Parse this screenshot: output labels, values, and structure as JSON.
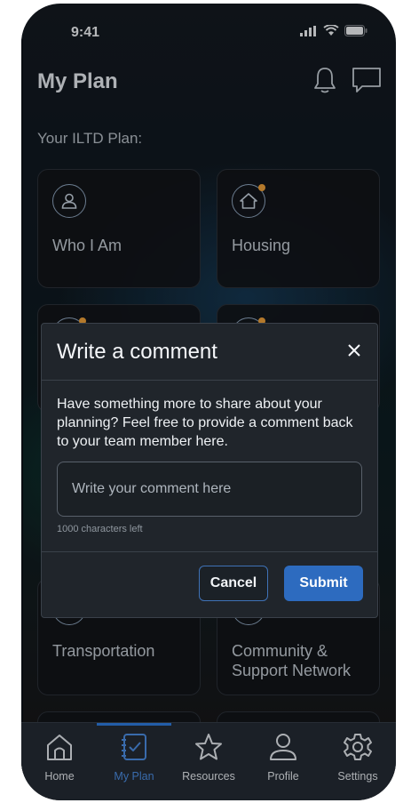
{
  "status_bar": {
    "time": "9:41"
  },
  "header": {
    "title": "My Plan",
    "subtitle": "Your ILTD Plan:",
    "bell_icon": "bell-icon",
    "comment_icon": "comment-icon"
  },
  "cards": [
    {
      "label": "Who I Am",
      "icon": "person-icon",
      "notification": false
    },
    {
      "label": "Housing",
      "icon": "house-icon",
      "notification": true
    },
    {
      "label": "Transportation",
      "icon": "car-icon",
      "notification": false
    },
    {
      "label": "Community &",
      "label2": "Support Network",
      "icon": "people-icon",
      "notification": false
    }
  ],
  "modal": {
    "title": "Write a comment",
    "description": "Have something more to share about your planning? Feel free to provide a comment back to your team member here.",
    "field_placeholder": "Write your comment here",
    "char_count": "1000 characters left",
    "cancel_label": "Cancel",
    "submit_label": "Submit"
  },
  "nav": {
    "items": [
      {
        "label": "Home",
        "icon": "home-icon",
        "active": false
      },
      {
        "label": "My Plan",
        "icon": "plan-icon",
        "active": true
      },
      {
        "label": "Resources",
        "icon": "star-icon",
        "active": false
      },
      {
        "label": "Profile",
        "icon": "profile-icon",
        "active": false
      },
      {
        "label": "Settings",
        "icon": "gear-icon",
        "active": false
      }
    ]
  },
  "colors": {
    "accent": "#2d6bbf",
    "active_nav": "#4d8fe6",
    "notification_dot": "#f0a23a"
  }
}
